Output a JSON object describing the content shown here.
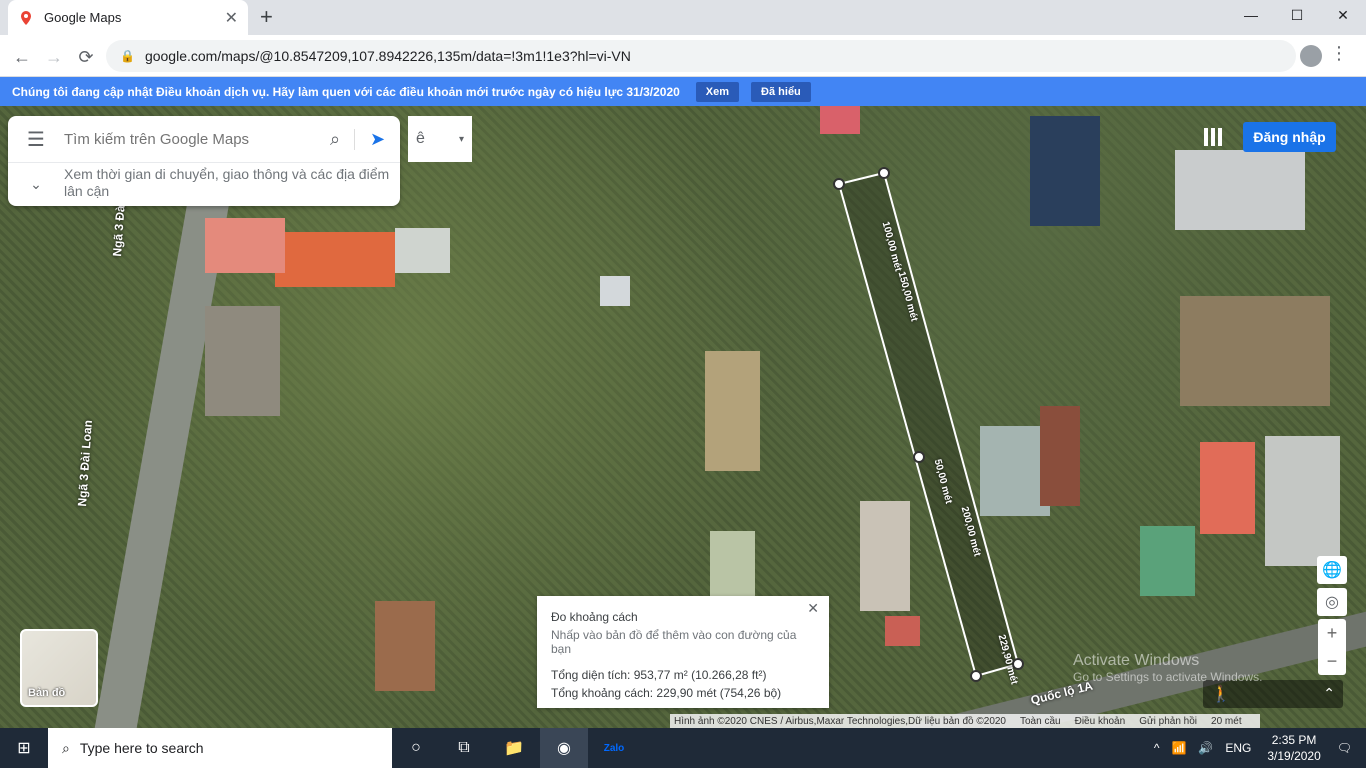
{
  "browser": {
    "tab_title": "Google Maps",
    "tab_close": "✕",
    "new_tab": "+",
    "url": "google.com/maps/@10.8547209,107.8942226,135m/data=!3m1!1e3?hl=vi-VN",
    "window_controls": [
      "—",
      "☐",
      "✕"
    ]
  },
  "banner": {
    "text": "Chúng tôi đang cập nhật Điều khoản dịch vụ. Hãy làm quen với các điều khoản mới trước ngày có hiệu lực 31/3/2020",
    "view_label": "Xem",
    "understood_label": "Đã hiểu"
  },
  "search": {
    "placeholder": "Tìm kiếm trên Google Maps",
    "sub_text": "Xem thời gian di chuyển, giao thông và các địa điểm lân cận",
    "ime_label": "ê"
  },
  "header": {
    "login_label": "Đăng nhập"
  },
  "measure": {
    "title": "Đo khoảng cách",
    "hint": "Nhấp vào bản đồ để thêm vào con đường của bạn",
    "area": "Tổng diện tích: 953,77 m² (10.266,28 ft²)",
    "distance": "Tổng khoảng cách: 229,90 mét (754,26 bộ)",
    "close": "✕"
  },
  "map": {
    "road_label_1": "Ngã 3 Đài Loan",
    "road_label_2": "Ngã 3 Đài Loan",
    "road_label_3": "Quốc lộ 1A",
    "segment_labels": [
      "100,00 mét",
      "150,00 mét",
      "50,00 mét",
      "200,00 mét",
      "229,90 mét"
    ],
    "minimap_label": "Bản đồ",
    "zoom_in": "+",
    "zoom_out": "−"
  },
  "footer": {
    "attribution": "Hình ảnh ©2020 CNES / Airbus,Maxar Technologies,Dữ liệu bản đồ ©2020",
    "global": "Toàn cầu",
    "terms": "Điều khoản",
    "feedback": "Gửi phản hồi",
    "scale": "20 mét"
  },
  "watermark": {
    "title": "Activate Windows",
    "sub": "Go to Settings to activate Windows."
  },
  "taskbar": {
    "search_placeholder": "Type here to search",
    "lang": "ENG",
    "time": "2:35 PM",
    "date": "3/19/2020",
    "zalo": "Zalo"
  },
  "colors": {
    "accent": "#1a73e8",
    "banner": "#4285f4",
    "taskbar": "#1f2a38"
  }
}
